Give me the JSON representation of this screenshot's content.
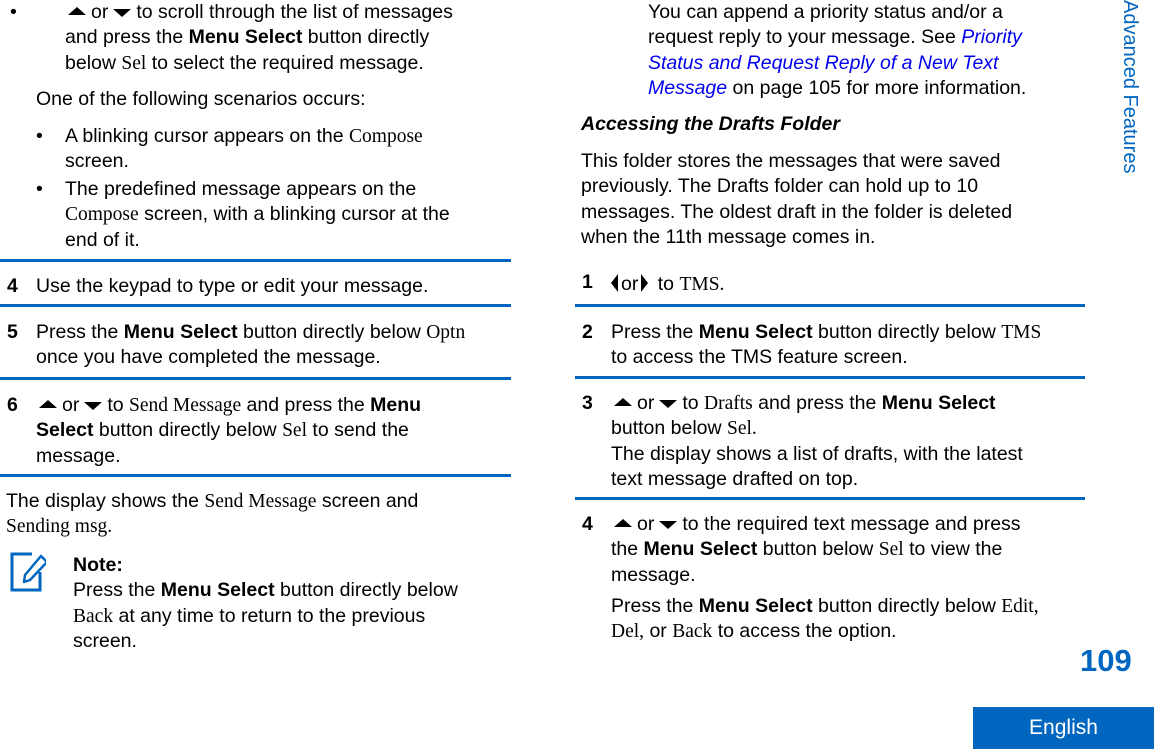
{
  "left": {
    "bullet_scroll": {
      "or": "or",
      "text1": "to scroll through the list of messages",
      "text2_pre": "and press the ",
      "text2_bold": "Menu Select",
      "text2_post": " button directly",
      "text3_pre": "below ",
      "text3_ui": "Sel",
      "text3_post": " to select the required message."
    },
    "scenarios_intro": "One of the following scenarios occurs:",
    "scenario1": {
      "line1_pre": "A blinking cursor appears on the ",
      "line1_ui": "Compose",
      "line2": "screen."
    },
    "scenario2": {
      "line1": "The predefined message appears on the",
      "line2_ui": "Compose",
      "line2_post": " screen, with a blinking cursor at the",
      "line3": "end of it."
    },
    "step4": {
      "num": "4",
      "text": "Use the keypad to type or edit your message."
    },
    "step5": {
      "num": "5",
      "line1_pre": "Press the ",
      "line1_bold": "Menu Select",
      "line1_post": " button directly below ",
      "line1_ui": "Optn",
      "line2": "once you have completed the message."
    },
    "step6": {
      "num": "6",
      "or": "or",
      "line1_pre": "to ",
      "line1_ui": "Send Message",
      "line1_post": " and press the ",
      "line1_bold": "Menu",
      "line2_bold": "Select",
      "line2_post": " button directly below ",
      "line2_ui": "Sel",
      "line2_end": " to send the",
      "line3": "message."
    },
    "result": {
      "line1_pre": "The display shows the ",
      "line1_ui": "Send Message",
      "line1_post": " screen and",
      "line2_ui": "Sending msg."
    },
    "note": {
      "title": "Note:",
      "line1_pre": "Press the ",
      "line1_bold": "Menu Select",
      "line1_post": " button directly below",
      "line2_ui": "Back",
      "line2_post": " at any time to return to the previous",
      "line3": "screen."
    }
  },
  "right": {
    "intro": {
      "line1": "You can append a priority status and/or a",
      "line2_pre": "request reply to your message. See ",
      "line2_link": "Priority",
      "line3_link": "Status and Request Reply of a New Text",
      "line4_link": "Message",
      "line4_post": " on page 105 for more information."
    },
    "heading": "Accessing the Drafts Folder",
    "desc": [
      "This folder stores the messages that were saved",
      "previously. The Drafts folder can hold up to 10",
      "messages. The oldest draft in the folder is deleted",
      "when the 11th message comes in."
    ],
    "step1": {
      "num": "1",
      "or": "or",
      "to": " to ",
      "ui": "TMS."
    },
    "step2": {
      "num": "2",
      "line1_pre": "Press the ",
      "line1_bold": "Menu Select",
      "line1_post": " button directly below ",
      "line1_ui": "TMS",
      "line2": "to access the TMS feature screen."
    },
    "step3": {
      "num": "3",
      "or": "or",
      "line1_pre": "to ",
      "line1_ui": "Drafts",
      "line1_post": " and press the ",
      "line1_bold": "Menu Select",
      "line2_pre": "button below ",
      "line2_ui": "Sel.",
      "line3": "The display shows a list of drafts, with the latest",
      "line4": "text message drafted on top."
    },
    "step4": {
      "num": "4",
      "or": "or",
      "line1_post": "to the required text message and press",
      "line2_pre": "the ",
      "line2_bold": "Menu Select",
      "line2_post": " button below ",
      "line2_ui": "Sel",
      "line2_end": " to view the",
      "line3": "message.",
      "line4_pre": "Press the ",
      "line4_bold": "Menu Select",
      "line4_post": " button directly below ",
      "line4_ui": "Edit,",
      "line5_ui1": "Del,",
      "line5_mid": " or ",
      "line5_ui2": "Back",
      "line5_post": " to access the option."
    }
  },
  "sidebar": {
    "section_title": "Advanced Features"
  },
  "footer": {
    "page_number": "109",
    "language": "English"
  },
  "colors": {
    "accent": "#0066c0",
    "link": "#0000ee",
    "text": "#000000"
  }
}
